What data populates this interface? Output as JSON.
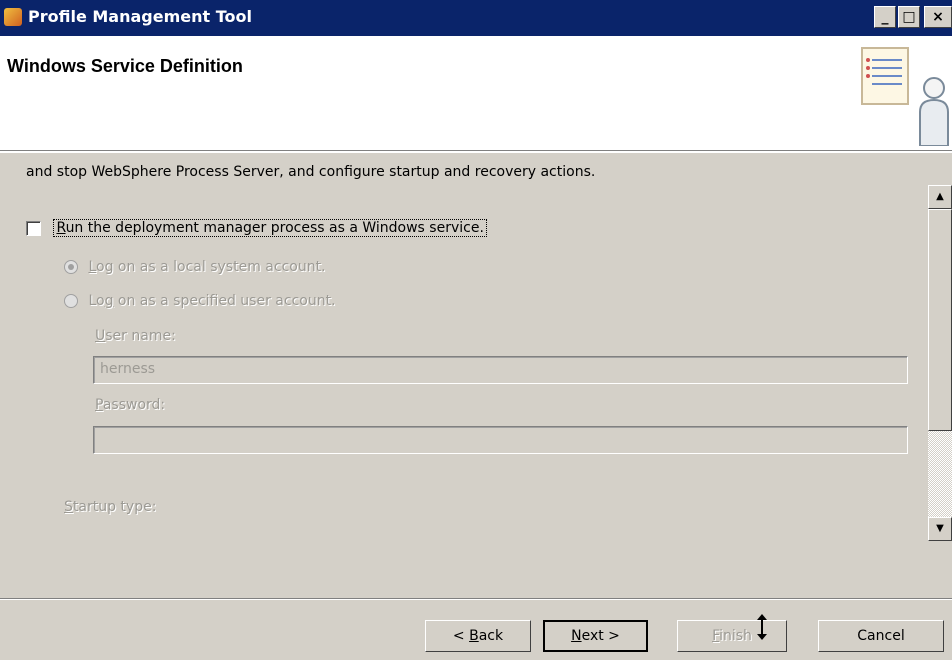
{
  "window": {
    "title": "Profile Management Tool",
    "minimize": "_",
    "maximize": "□",
    "close": "×"
  },
  "header": {
    "title": "Windows Service Definition"
  },
  "content": {
    "description": "and stop WebSphere Process Server, and configure startup and recovery actions.",
    "run_as_service": {
      "label_pre": "",
      "label_accel": "R",
      "label_post": "un the deployment manager process as a Windows service.",
      "checked": false
    },
    "logon_local": {
      "label_pre": "",
      "label_accel": "L",
      "label_post": "og on as a local system account.",
      "selected": true
    },
    "logon_user": {
      "label_pre": "Lo",
      "label_accel": "g",
      "label_post": " on as a specified user account.",
      "selected": false
    },
    "user_name": {
      "label_accel": "U",
      "label_post": "ser name:",
      "value": "herness"
    },
    "password": {
      "label_accel": "P",
      "label_post": "assword:",
      "value": ""
    },
    "startup_type": {
      "label_accel": "S",
      "label_post": "tartup type:"
    }
  },
  "buttons": {
    "back": {
      "pre": "< ",
      "accel": "B",
      "post": "ack"
    },
    "next": {
      "pre": "",
      "accel": "N",
      "post": "ext >"
    },
    "finish": {
      "pre": "",
      "accel": "F",
      "post": "inish"
    },
    "cancel": "Cancel"
  },
  "colors": {
    "titlebar": "#0a246a",
    "dialog_bg": "#d4d0c8",
    "disabled_text": "#9c9a94"
  }
}
